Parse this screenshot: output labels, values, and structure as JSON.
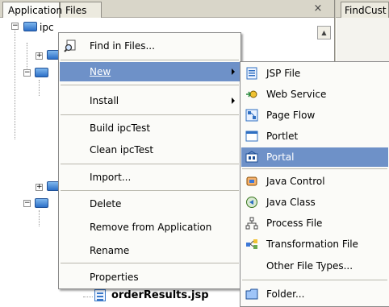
{
  "tabs": {
    "application": "Application",
    "files": "Files",
    "close_glyph": "×",
    "findcust": "FindCust"
  },
  "tree": {
    "root_label": "ipc",
    "jsp_file": "orderResults.jsp"
  },
  "context_menu": {
    "find_in_files": "Find in Files...",
    "new": "New",
    "install": "Install",
    "build": "Build ipcTest",
    "clean": "Clean ipcTest",
    "import": "Import...",
    "delete": "Delete",
    "remove": "Remove from Application",
    "rename": "Rename",
    "properties": "Properties"
  },
  "new_submenu": {
    "jsp_file": "JSP File",
    "web_service": "Web Service",
    "page_flow": "Page Flow",
    "portlet": "Portlet",
    "portal": "Portal",
    "java_control": "Java Control",
    "java_class": "Java Class",
    "process_file": "Process File",
    "transformation_file": "Transformation File",
    "other_file_types": "Other File Types...",
    "folder": "Folder..."
  },
  "colors": {
    "highlight": "#6e91c8",
    "menu_bg": "#fbfbf8"
  }
}
